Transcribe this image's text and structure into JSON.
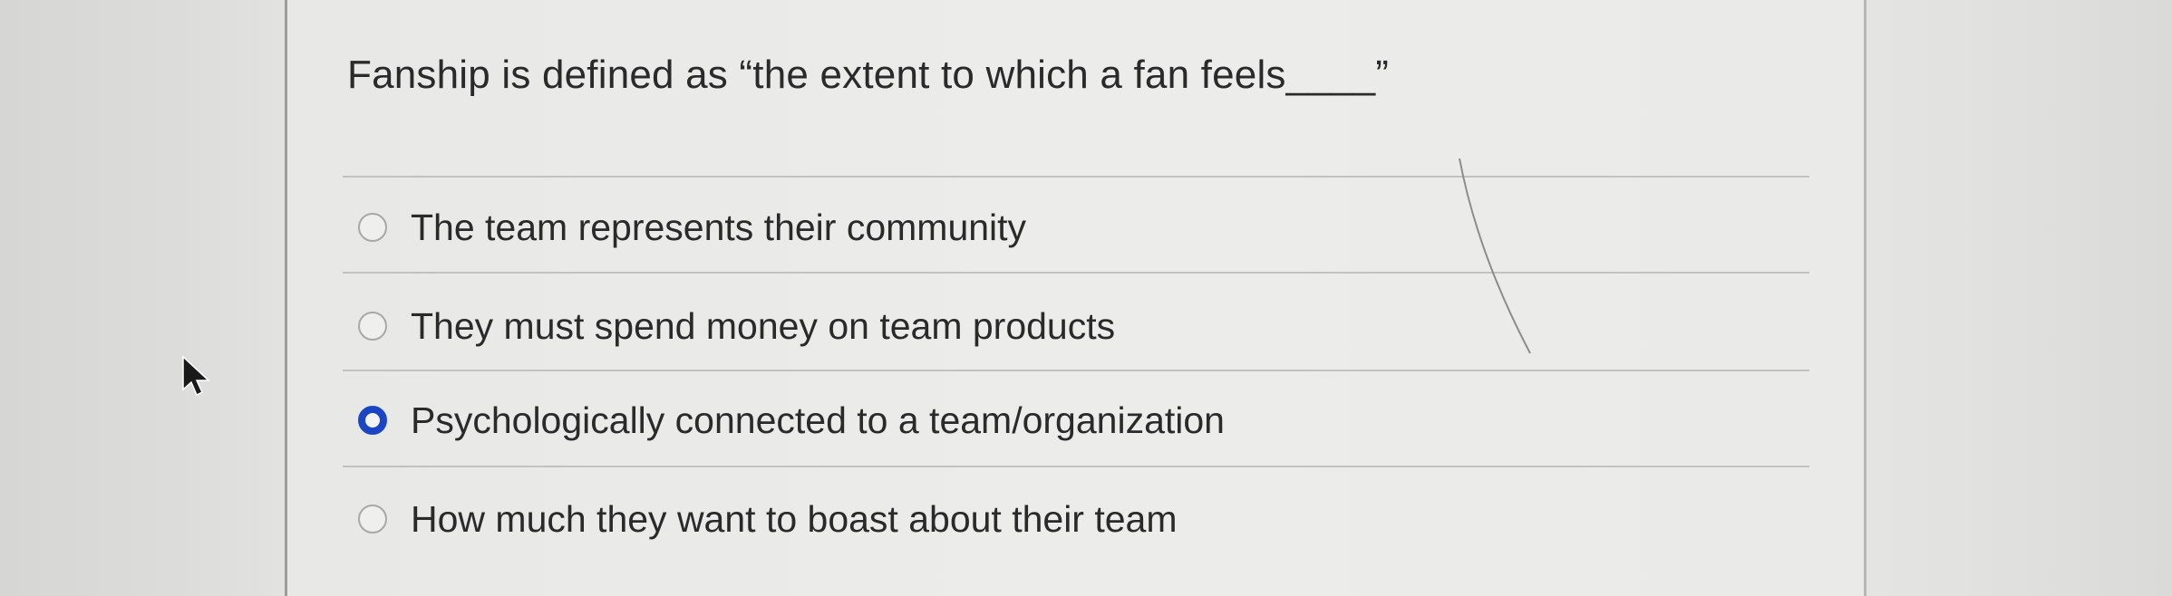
{
  "question": {
    "prompt": "Fanship is defined as “the extent to which a fan feels____”"
  },
  "options": [
    {
      "label": "The team represents their community",
      "selected": false
    },
    {
      "label": "They must spend money on team products",
      "selected": false
    },
    {
      "label": "Psychologically connected to a team/organization",
      "selected": true
    },
    {
      "label": "How much they want to boast about their team",
      "selected": false
    }
  ],
  "colors": {
    "selected_radio": "#1a46c4",
    "text": "#2a2a2a",
    "background": "#ebebea"
  },
  "icons": {
    "cursor": "mouse-pointer-icon",
    "radio_unselected": "radio-empty-icon",
    "radio_selected": "radio-filled-icon"
  }
}
